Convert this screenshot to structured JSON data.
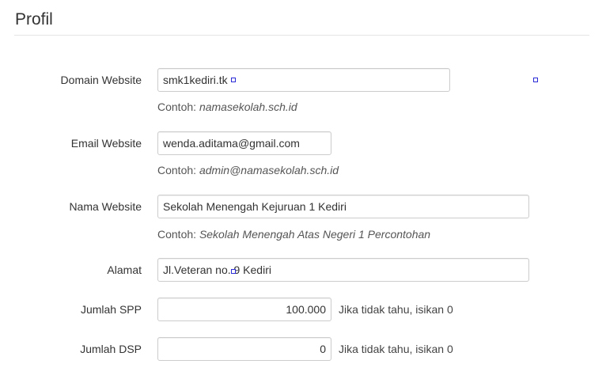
{
  "header": {
    "title": "Profil"
  },
  "form": {
    "domain": {
      "label": "Domain Website",
      "value": "smk1kediri.tk",
      "help_prefix": "Contoh: ",
      "help_example": "namasekolah.sch.id"
    },
    "email": {
      "label": "Email Website",
      "value": "wenda.aditama@gmail.com",
      "help_prefix": "Contoh: ",
      "help_example": "admin@namasekolah.sch.id"
    },
    "nama": {
      "label": "Nama Website",
      "value": "Sekolah Menengah Kejuruan 1 Kediri",
      "help_prefix": "Contoh: ",
      "help_example": "Sekolah Menengah Atas Negeri 1 Percontohan"
    },
    "alamat": {
      "label": "Alamat",
      "value": "Jl.Veteran no. 9 Kediri"
    },
    "spp": {
      "label": "Jumlah SPP",
      "value": "100.000",
      "note": "Jika tidak tahu, isikan 0"
    },
    "dsp": {
      "label": "Jumlah DSP",
      "value": "0",
      "note": "Jika tidak tahu, isikan 0"
    }
  },
  "colors": {
    "handle": "#2b2bd8",
    "border": "#cccccc",
    "divider": "#e5e5e5"
  }
}
